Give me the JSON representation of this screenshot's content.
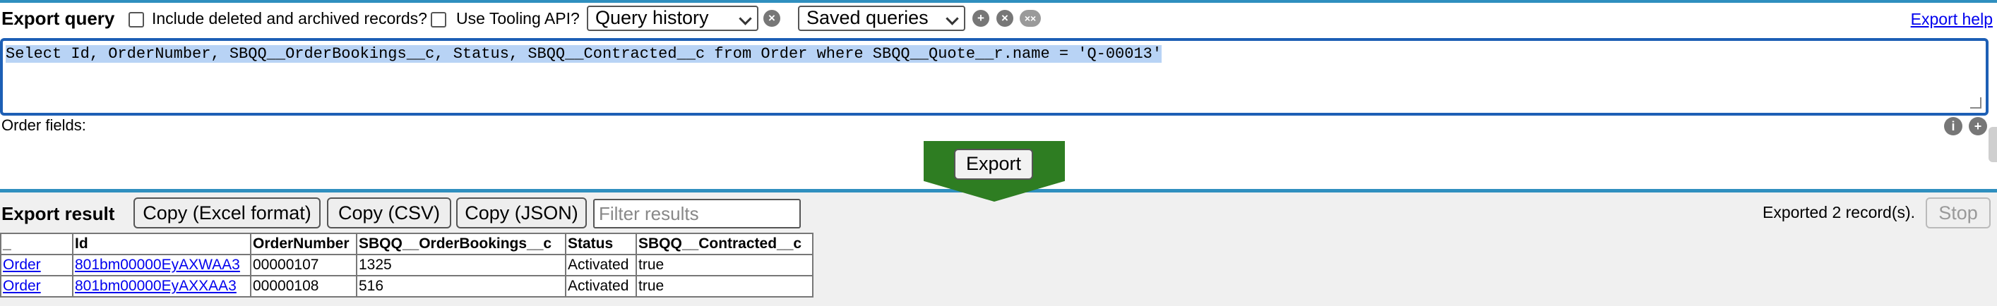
{
  "query": {
    "title": "Export query",
    "include_deleted_label": "Include deleted and archived records?",
    "tooling_api_label": "Use Tooling API?",
    "history_select_value": "Query history",
    "saved_select_value": "Saved queries",
    "help_link": "Export help",
    "soql": "Select Id, OrderNumber, SBQQ__OrderBookings__c, Status, SBQQ__Contracted__c from Order where SBQQ__Quote__r.name = 'Q-00013'",
    "fields_label": "Order fields:"
  },
  "export_button_label": "Export",
  "result": {
    "title": "Export result",
    "copy_excel_label": "Copy (Excel format)",
    "copy_csv_label": "Copy (CSV)",
    "copy_json_label": "Copy (JSON)",
    "filter_placeholder": "Filter results",
    "record_count": "Exported 2 record(s).",
    "stop_label": "Stop",
    "columns": [
      "_",
      "Id",
      "OrderNumber",
      "SBQQ__OrderBookings__c",
      "Status",
      "SBQQ__Contracted__c"
    ],
    "rows": [
      [
        "Order",
        "801bm00000EyAXWAA3",
        "00000107",
        "1325",
        "Activated",
        "true"
      ],
      [
        "Order",
        "801bm00000EyAXXAA3",
        "00000108",
        "516",
        "Activated",
        "true"
      ]
    ]
  },
  "colors": {
    "accent_blue": "#2f8fbf",
    "export_green": "#2e7d22",
    "link_blue": "#0000ee"
  },
  "icons": {
    "clear_history": "x-circle-icon",
    "save_query": "plus-circle-icon",
    "remove_saved": "x-circle-icon",
    "clear_saved": "xx-circle-icon",
    "field_info": "info-icon",
    "field_add": "plus-circle-icon"
  }
}
